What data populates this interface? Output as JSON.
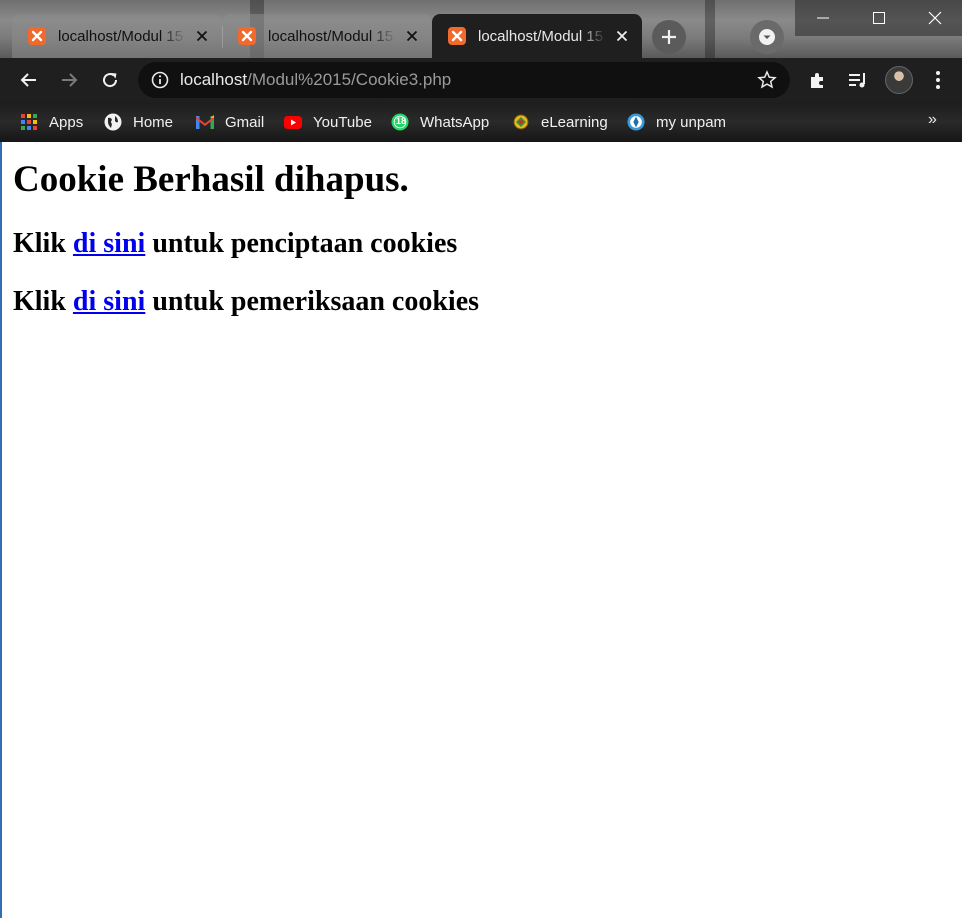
{
  "browser": {
    "tabs": [
      {
        "title": "localhost/Modul 15",
        "active": false
      },
      {
        "title": "localhost/Modul 15",
        "active": false
      },
      {
        "title": "localhost/Modul 15",
        "active": true
      }
    ],
    "address": {
      "host": "localhost",
      "path": "/Modul%2015/Cookie3.php"
    },
    "bookmarks": [
      {
        "label": "Apps",
        "icon": "apps-grid-icon"
      },
      {
        "label": "Home",
        "icon": "globe-icon"
      },
      {
        "label": "Gmail",
        "icon": "gmail-icon"
      },
      {
        "label": "YouTube",
        "icon": "youtube-icon"
      },
      {
        "label": "WhatsApp",
        "icon": "whatsapp-icon",
        "badge": "18"
      },
      {
        "label": "eLearning",
        "icon": "elearning-icon"
      },
      {
        "label": "my unpam",
        "icon": "unpam-icon"
      }
    ],
    "bookmarks_overflow": "»"
  },
  "page": {
    "heading": "Cookie Berhasil dihapus.",
    "lines": [
      {
        "prefix": "Klik ",
        "link": "di sini",
        "suffix": " untuk penciptaan cookies"
      },
      {
        "prefix": "Klik ",
        "link": "di sini",
        "suffix": " untuk pemeriksaan cookies"
      }
    ]
  },
  "colors": {
    "link": "#0000ee",
    "xampp_favicon": "#f0692d",
    "page_background": "#ffffff"
  }
}
